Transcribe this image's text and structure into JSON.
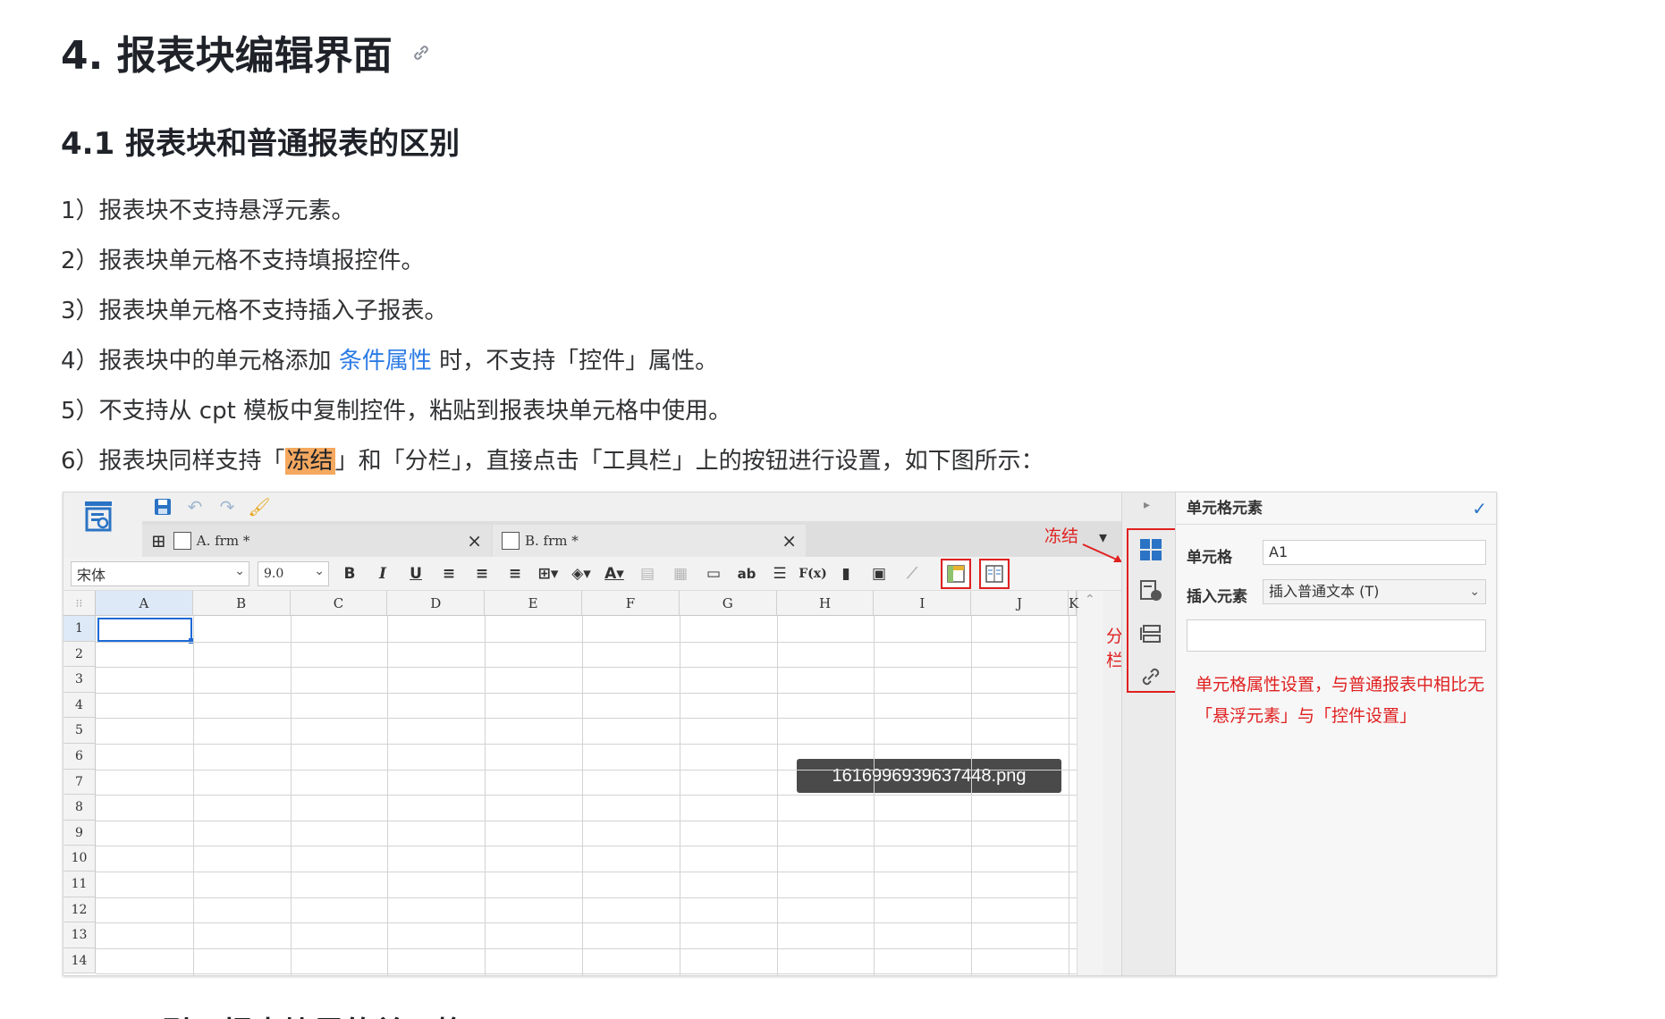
{
  "heading": {
    "title": "4. 报表块编辑界面",
    "anchor_icon": "link-icon"
  },
  "section": {
    "title": "4.1 报表块和普通报表的区别",
    "items": [
      {
        "text": "1）报表块不支持悬浮元素。"
      },
      {
        "text": "2）报表块单元格不支持填报控件。"
      },
      {
        "text": "3）报表块单元格不支持插入子报表。"
      },
      {
        "pre": "4）报表块中的单元格添加 ",
        "link": "条件属性",
        "post": " 时，不支持「控件」属性。"
      },
      {
        "text": "5）不支持从 cpt 模板中复制控件，粘贴到报表块单元格中使用。"
      },
      {
        "pre": "6）报表块同样支持「",
        "highlight": "冻结",
        "post": "」和「分栏」，直接点击「工具栏」上的按钮进行设置，如下图所示："
      }
    ]
  },
  "screenshot": {
    "tabs": [
      {
        "label": "A. frm *"
      },
      {
        "label": "B. frm *"
      }
    ],
    "font_name": "宋体",
    "font_size": "9.0",
    "format_buttons": {
      "bold": "B",
      "italic": "I",
      "underline": "U"
    },
    "text_tools": {
      "ab": "ab",
      "formula": "F(x)"
    },
    "columns": [
      "A",
      "B",
      "C",
      "D",
      "E",
      "F",
      "G",
      "H",
      "I",
      "J",
      "K"
    ],
    "rows": [
      "1",
      "2",
      "3",
      "4",
      "5",
      "6",
      "7",
      "8",
      "9",
      "10",
      "11",
      "12",
      "13",
      "14"
    ],
    "tooltip": "1616996939637448.png",
    "annotations": {
      "freeze": "冻结",
      "columns_split": "分栏"
    },
    "panel": {
      "title": "单元格元素",
      "cell_label": "单元格",
      "cell_value": "A1",
      "insert_label": "插入元素",
      "insert_value": "插入普通文本 (T)",
      "note": "单元格属性设置，与普通报表中相比无「悬浮元素」与「控件设置」"
    }
  },
  "next_heading_fragment": "... 引用报表块里的单元格"
}
